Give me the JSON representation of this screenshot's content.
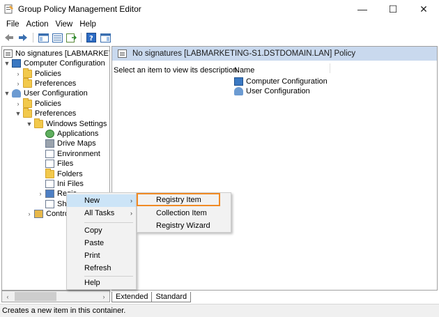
{
  "window": {
    "title": "Group Policy Management Editor",
    "controls": {
      "minimize": "—",
      "maximize": "☐",
      "close": "✕"
    }
  },
  "menubar": [
    "File",
    "Action",
    "View",
    "Help"
  ],
  "toolbar": {
    "icons": [
      "back-icon",
      "forward-icon",
      "show-hide-tree-icon",
      "properties-icon",
      "export-list-icon",
      "help-icon",
      "show-hide-action-pane-icon"
    ]
  },
  "tree": {
    "root": "No signatures [LABMARKETING-",
    "items": [
      {
        "label": "Computer Configuration",
        "icon": "computer-config-icon"
      },
      {
        "label": "Policies",
        "icon": "folder-icon"
      },
      {
        "label": "Preferences",
        "icon": "folder-icon"
      },
      {
        "label": "User Configuration",
        "icon": "user-config-icon"
      },
      {
        "label": "Policies",
        "icon": "folder-icon"
      },
      {
        "label": "Preferences",
        "icon": "folder-icon"
      },
      {
        "label": "Windows Settings",
        "icon": "folder-icon"
      },
      {
        "label": "Applications",
        "icon": "applications-icon"
      },
      {
        "label": "Drive Maps",
        "icon": "drive-maps-icon"
      },
      {
        "label": "Environment",
        "icon": "environment-icon"
      },
      {
        "label": "Files",
        "icon": "files-icon"
      },
      {
        "label": "Folders",
        "icon": "folders-icon"
      },
      {
        "label": "Ini Files",
        "icon": "ini-files-icon"
      },
      {
        "label": "Regis",
        "icon": "registry-icon"
      },
      {
        "label": "Sho",
        "icon": "shortcuts-icon"
      },
      {
        "label": "Contro",
        "icon": "control-panel-icon"
      }
    ]
  },
  "detail": {
    "header": "No signatures [LABMARKETING-S1.DSTDOMAIN.LAN] Policy",
    "description": "Select an item to view its description.",
    "column_name": "Name",
    "rows": [
      {
        "label": "Computer Configuration",
        "icon": "computer-config-icon"
      },
      {
        "label": "User Configuration",
        "icon": "user-config-icon"
      }
    ]
  },
  "tabs": [
    "Extended",
    "Standard"
  ],
  "status": "Creates a new item in this container.",
  "context_menu": {
    "items": [
      "New",
      "All Tasks",
      "Copy",
      "Paste",
      "Print",
      "Refresh",
      "Help"
    ],
    "active_item": "New"
  },
  "submenu": {
    "items": [
      "Registry Item",
      "Collection Item",
      "Registry Wizard"
    ],
    "highlighted": "Registry Item",
    "highlight_color": "#f08a24"
  }
}
